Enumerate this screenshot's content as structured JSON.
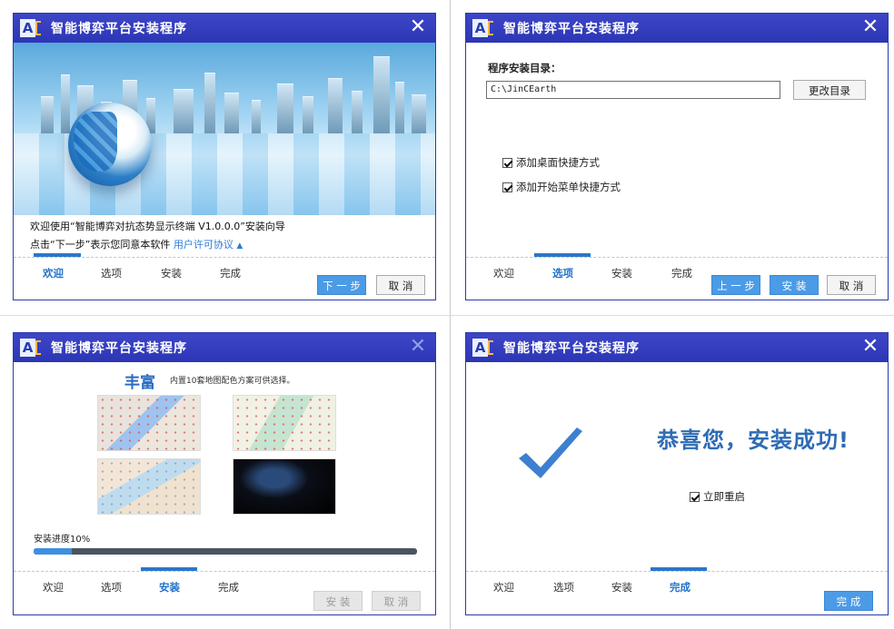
{
  "app": {
    "title": "智能博弈平台安装程序",
    "logo_letter": "A"
  },
  "tabs": [
    "欢迎",
    "选项",
    "安装",
    "完成"
  ],
  "window1": {
    "welcome_text": "欢迎使用“智能博弈对抗态势显示终端 V1.0.0.0”安装向导",
    "agree_text": "点击“下一步”表示您同意本软件",
    "license_link": "用户许可协议",
    "license_arrow": "▲",
    "active_tab": "欢迎",
    "next_button": "下 一 步",
    "cancel_button": "取 消"
  },
  "window2": {
    "dir_label": "程序安装目录：",
    "dir_value": "C:\\JinCEarth",
    "change_dir_button": "更改目录",
    "desktop_shortcut_label": "添加桌面快捷方式",
    "desktop_shortcut_checked": true,
    "startmenu_shortcut_label": "添加开始菜单快捷方式",
    "startmenu_shortcut_checked": true,
    "active_tab": "选项",
    "prev_button": "上 一 步",
    "install_button": "安 装",
    "cancel_button": "取 消"
  },
  "window3": {
    "feature_title": "丰富",
    "feature_desc": "内置10套地图配色方案可供选择。",
    "progress_label": "安装进度10%",
    "progress_value": 0.1,
    "active_tab": "安装",
    "install_button": "安 装",
    "cancel_button": "取 消"
  },
  "window4": {
    "success_message": "恭喜您，安装成功!",
    "restart_label": "立即重启",
    "restart_checked": true,
    "active_tab": "完成",
    "finish_button": "完 成"
  },
  "colors": {
    "titlebar": "#2c36b5",
    "accent": "#2a77cc",
    "button_blue": "#4b9be6",
    "success_text": "#2f6cb4"
  }
}
